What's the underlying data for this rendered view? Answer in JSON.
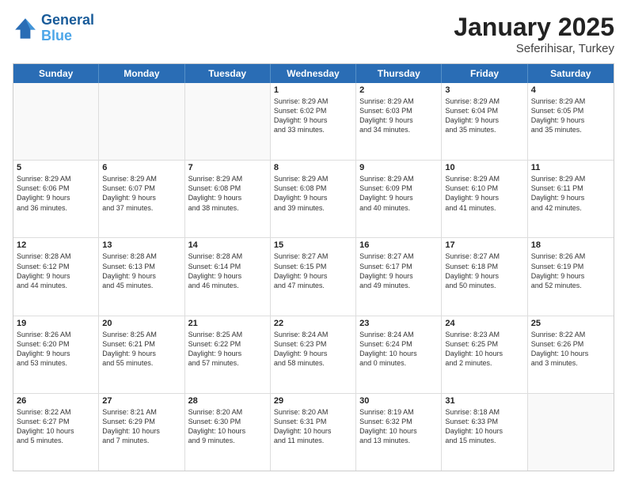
{
  "header": {
    "logo_line1": "General",
    "logo_line2": "Blue",
    "month": "January 2025",
    "location": "Seferihisar, Turkey"
  },
  "weekdays": [
    "Sunday",
    "Monday",
    "Tuesday",
    "Wednesday",
    "Thursday",
    "Friday",
    "Saturday"
  ],
  "weeks": [
    [
      {
        "day": "",
        "data": ""
      },
      {
        "day": "",
        "data": ""
      },
      {
        "day": "",
        "data": ""
      },
      {
        "day": "1",
        "data": "Sunrise: 8:29 AM\nSunset: 6:02 PM\nDaylight: 9 hours\nand 33 minutes."
      },
      {
        "day": "2",
        "data": "Sunrise: 8:29 AM\nSunset: 6:03 PM\nDaylight: 9 hours\nand 34 minutes."
      },
      {
        "day": "3",
        "data": "Sunrise: 8:29 AM\nSunset: 6:04 PM\nDaylight: 9 hours\nand 35 minutes."
      },
      {
        "day": "4",
        "data": "Sunrise: 8:29 AM\nSunset: 6:05 PM\nDaylight: 9 hours\nand 35 minutes."
      }
    ],
    [
      {
        "day": "5",
        "data": "Sunrise: 8:29 AM\nSunset: 6:06 PM\nDaylight: 9 hours\nand 36 minutes."
      },
      {
        "day": "6",
        "data": "Sunrise: 8:29 AM\nSunset: 6:07 PM\nDaylight: 9 hours\nand 37 minutes."
      },
      {
        "day": "7",
        "data": "Sunrise: 8:29 AM\nSunset: 6:08 PM\nDaylight: 9 hours\nand 38 minutes."
      },
      {
        "day": "8",
        "data": "Sunrise: 8:29 AM\nSunset: 6:08 PM\nDaylight: 9 hours\nand 39 minutes."
      },
      {
        "day": "9",
        "data": "Sunrise: 8:29 AM\nSunset: 6:09 PM\nDaylight: 9 hours\nand 40 minutes."
      },
      {
        "day": "10",
        "data": "Sunrise: 8:29 AM\nSunset: 6:10 PM\nDaylight: 9 hours\nand 41 minutes."
      },
      {
        "day": "11",
        "data": "Sunrise: 8:29 AM\nSunset: 6:11 PM\nDaylight: 9 hours\nand 42 minutes."
      }
    ],
    [
      {
        "day": "12",
        "data": "Sunrise: 8:28 AM\nSunset: 6:12 PM\nDaylight: 9 hours\nand 44 minutes."
      },
      {
        "day": "13",
        "data": "Sunrise: 8:28 AM\nSunset: 6:13 PM\nDaylight: 9 hours\nand 45 minutes."
      },
      {
        "day": "14",
        "data": "Sunrise: 8:28 AM\nSunset: 6:14 PM\nDaylight: 9 hours\nand 46 minutes."
      },
      {
        "day": "15",
        "data": "Sunrise: 8:27 AM\nSunset: 6:15 PM\nDaylight: 9 hours\nand 47 minutes."
      },
      {
        "day": "16",
        "data": "Sunrise: 8:27 AM\nSunset: 6:17 PM\nDaylight: 9 hours\nand 49 minutes."
      },
      {
        "day": "17",
        "data": "Sunrise: 8:27 AM\nSunset: 6:18 PM\nDaylight: 9 hours\nand 50 minutes."
      },
      {
        "day": "18",
        "data": "Sunrise: 8:26 AM\nSunset: 6:19 PM\nDaylight: 9 hours\nand 52 minutes."
      }
    ],
    [
      {
        "day": "19",
        "data": "Sunrise: 8:26 AM\nSunset: 6:20 PM\nDaylight: 9 hours\nand 53 minutes."
      },
      {
        "day": "20",
        "data": "Sunrise: 8:25 AM\nSunset: 6:21 PM\nDaylight: 9 hours\nand 55 minutes."
      },
      {
        "day": "21",
        "data": "Sunrise: 8:25 AM\nSunset: 6:22 PM\nDaylight: 9 hours\nand 57 minutes."
      },
      {
        "day": "22",
        "data": "Sunrise: 8:24 AM\nSunset: 6:23 PM\nDaylight: 9 hours\nand 58 minutes."
      },
      {
        "day": "23",
        "data": "Sunrise: 8:24 AM\nSunset: 6:24 PM\nDaylight: 10 hours\nand 0 minutes."
      },
      {
        "day": "24",
        "data": "Sunrise: 8:23 AM\nSunset: 6:25 PM\nDaylight: 10 hours\nand 2 minutes."
      },
      {
        "day": "25",
        "data": "Sunrise: 8:22 AM\nSunset: 6:26 PM\nDaylight: 10 hours\nand 3 minutes."
      }
    ],
    [
      {
        "day": "26",
        "data": "Sunrise: 8:22 AM\nSunset: 6:27 PM\nDaylight: 10 hours\nand 5 minutes."
      },
      {
        "day": "27",
        "data": "Sunrise: 8:21 AM\nSunset: 6:29 PM\nDaylight: 10 hours\nand 7 minutes."
      },
      {
        "day": "28",
        "data": "Sunrise: 8:20 AM\nSunset: 6:30 PM\nDaylight: 10 hours\nand 9 minutes."
      },
      {
        "day": "29",
        "data": "Sunrise: 8:20 AM\nSunset: 6:31 PM\nDaylight: 10 hours\nand 11 minutes."
      },
      {
        "day": "30",
        "data": "Sunrise: 8:19 AM\nSunset: 6:32 PM\nDaylight: 10 hours\nand 13 minutes."
      },
      {
        "day": "31",
        "data": "Sunrise: 8:18 AM\nSunset: 6:33 PM\nDaylight: 10 hours\nand 15 minutes."
      },
      {
        "day": "",
        "data": ""
      }
    ]
  ]
}
